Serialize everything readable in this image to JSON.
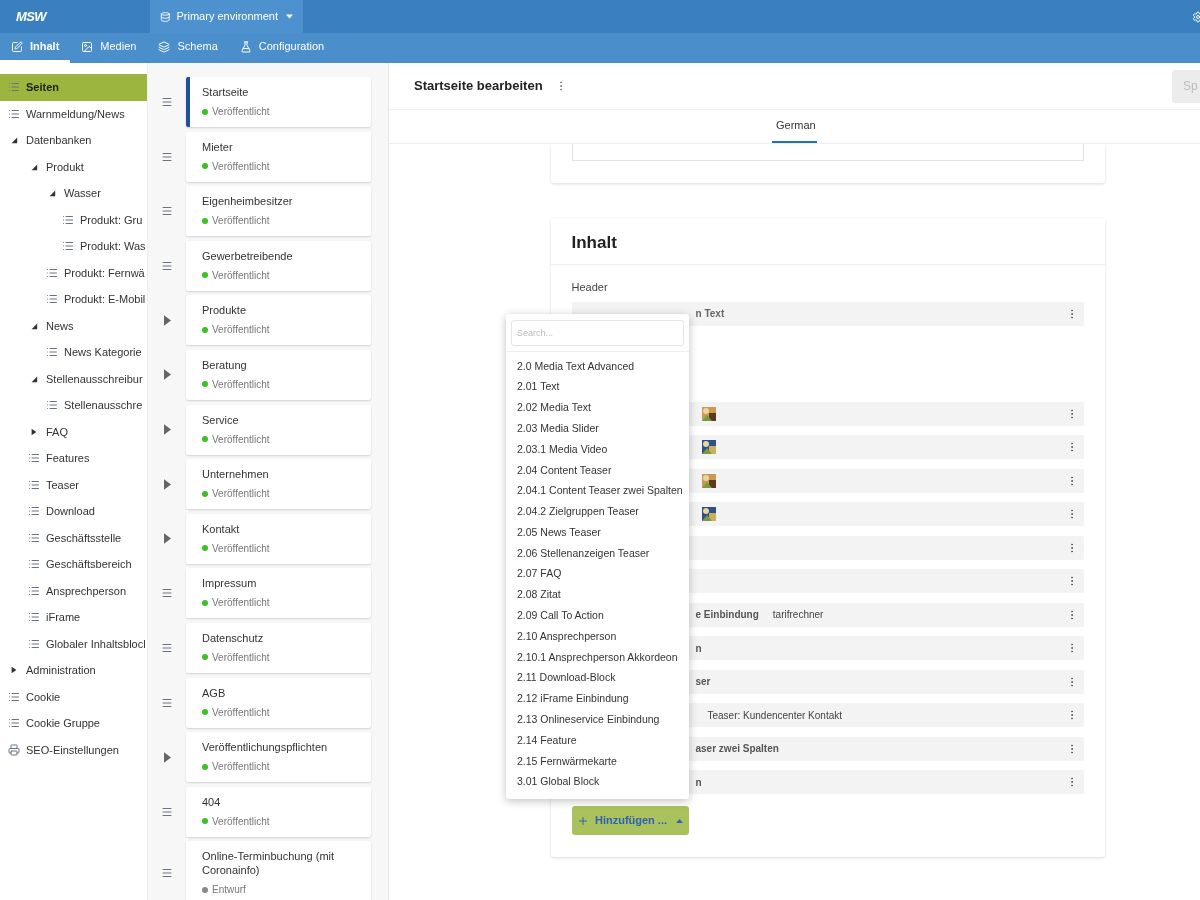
{
  "logo": "MSW",
  "environment": {
    "label": "Primary environment"
  },
  "nav": [
    {
      "label": "Inhalt",
      "selected": true
    },
    {
      "label": "Medien",
      "selected": false
    },
    {
      "label": "Schema",
      "selected": false
    },
    {
      "label": "Configuration",
      "selected": false
    }
  ],
  "sidebar": {
    "items": [
      {
        "label": "Seiten",
        "kind": "list",
        "selected": true
      },
      {
        "label": "Warnmeldung/News",
        "kind": "list",
        "selected": false
      },
      {
        "label": "Datenbanken",
        "kind": "folder",
        "expanded": true,
        "selected": false,
        "children": [
          {
            "label": "Produkt",
            "kind": "folder",
            "expanded": true,
            "selected": false,
            "children": [
              {
                "label": "Wasser",
                "kind": "folder",
                "expanded": true,
                "selected": false,
                "children": [
                  {
                    "label": "Produkt: Gru",
                    "kind": "list",
                    "selected": false
                  },
                  {
                    "label": "Produkt: Was",
                    "kind": "list",
                    "selected": false
                  }
                ]
              },
              {
                "label": "Produkt: Fernwä",
                "kind": "list",
                "selected": false
              },
              {
                "label": "Produkt: E-Mobil",
                "kind": "list",
                "selected": false
              }
            ]
          },
          {
            "label": "News",
            "kind": "folder",
            "expanded": true,
            "selected": false,
            "children": [
              {
                "label": "News Kategorie",
                "kind": "list",
                "selected": false
              }
            ]
          },
          {
            "label": "Stellenausschreibur",
            "kind": "folder",
            "expanded": true,
            "selected": false,
            "children": [
              {
                "label": "Stellenausschre",
                "kind": "list",
                "selected": false
              }
            ]
          },
          {
            "label": "FAQ",
            "kind": "folder",
            "expanded": false,
            "selected": false
          },
          {
            "label": "Features",
            "kind": "list",
            "selected": false
          },
          {
            "label": "Teaser",
            "kind": "list",
            "selected": false
          },
          {
            "label": "Download",
            "kind": "list",
            "selected": false
          },
          {
            "label": "Geschäftsstelle",
            "kind": "list",
            "selected": false
          },
          {
            "label": "Geschäftsbereich",
            "kind": "list",
            "selected": false
          },
          {
            "label": "Ansprechperson",
            "kind": "list",
            "selected": false
          },
          {
            "label": "iFrame",
            "kind": "list",
            "selected": false
          },
          {
            "label": "Globaler Inhaltsblocl",
            "kind": "list",
            "selected": false
          }
        ]
      },
      {
        "label": "Administration",
        "kind": "folder",
        "expanded": false,
        "selected": false
      },
      {
        "label": "Cookie",
        "kind": "list",
        "selected": false
      },
      {
        "label": "Cookie Gruppe",
        "kind": "list",
        "selected": false
      },
      {
        "label": "SEO-Einstellungen",
        "kind": "settings",
        "selected": false
      }
    ]
  },
  "pages": [
    {
      "title": "Startseite",
      "status": "Veröffentlicht",
      "published": true,
      "kind": "leaf",
      "selected": true
    },
    {
      "title": "Mieter",
      "status": "Veröffentlicht",
      "published": true,
      "kind": "leaf",
      "selected": false
    },
    {
      "title": "Eigenheimbesitzer",
      "status": "Veröffentlicht",
      "published": true,
      "kind": "leaf",
      "selected": false
    },
    {
      "title": "Gewerbetreibende",
      "status": "Veröffentlicht",
      "published": true,
      "kind": "leaf",
      "selected": false
    },
    {
      "title": "Produkte",
      "status": "Veröffentlicht",
      "published": true,
      "kind": "parent",
      "selected": false
    },
    {
      "title": "Beratung",
      "status": "Veröffentlicht",
      "published": true,
      "kind": "parent",
      "selected": false
    },
    {
      "title": "Service",
      "status": "Veröffentlicht",
      "published": true,
      "kind": "parent",
      "selected": false
    },
    {
      "title": "Unternehmen",
      "status": "Veröffentlicht",
      "published": true,
      "kind": "parent",
      "selected": false
    },
    {
      "title": "Kontakt",
      "status": "Veröffentlicht",
      "published": true,
      "kind": "parent",
      "selected": false
    },
    {
      "title": "Impressum",
      "status": "Veröffentlicht",
      "published": true,
      "kind": "leaf",
      "selected": false
    },
    {
      "title": "Datenschutz",
      "status": "Veröffentlicht",
      "published": true,
      "kind": "leaf",
      "selected": false
    },
    {
      "title": "AGB",
      "status": "Veröffentlicht",
      "published": true,
      "kind": "leaf",
      "selected": false
    },
    {
      "title": "Veröffentlichungspflichten",
      "status": "Veröffentlicht",
      "published": true,
      "kind": "parent",
      "selected": false
    },
    {
      "title": "404",
      "status": "Veröffentlicht",
      "published": true,
      "kind": "leaf",
      "selected": false
    },
    {
      "title": "Online-Terminbuchung (mit Coronainfo)",
      "status": "Entwurf",
      "published": false,
      "kind": "leaf",
      "selected": false
    }
  ],
  "editor": {
    "title": "Startseite bearbeiten",
    "save_button": "Sp",
    "languages": [
      {
        "label": "German",
        "selected": true
      }
    ],
    "section": {
      "title": "Inhalt",
      "header_label": "Header",
      "header_row": {
        "text": "n Text"
      },
      "rows": [
        {
          "kind": "picture"
        },
        {
          "kind": "picture"
        },
        {
          "kind": "picture"
        },
        {
          "kind": "picture"
        },
        {
          "kind": "text"
        },
        {
          "kind": "text"
        },
        {
          "kind": "text",
          "title": "e Einbindung",
          "subtitle": "tarifrechner"
        },
        {
          "kind": "text",
          "title": "n"
        },
        {
          "kind": "text",
          "title": "ser"
        },
        {
          "kind": "text",
          "subtitle": "Teaser: Kundencenter Kontakt"
        },
        {
          "kind": "text",
          "title": "aser zwei Spalten"
        },
        {
          "kind": "text",
          "title": "n"
        }
      ],
      "add_button": "Hinzufügen ..."
    }
  },
  "dropdown": {
    "placeholder": "Search...",
    "items": [
      "2.0 Media Text Advanced",
      "2.01 Text",
      "2.02 Media Text",
      "2.03 Media Slider",
      "2.03.1 Media Video",
      "2.04 Content Teaser",
      "2.04.1 Content Teaser zwei Spalten",
      "2.04.2 Zielgruppen Teaser",
      "2.05 News Teaser",
      "2.06 Stellenanzeigen Teaser",
      "2.07 FAQ",
      "2.08 Zitat",
      "2.09 Call To Action",
      "2.10 Ansprechperson",
      "2.10.1 Ansprechperson Akkordeon",
      "2.11 Download-Block",
      "2.12 iFrame Einbindung",
      "2.13 Onlineservice Einbindung",
      "2.14 Feature",
      "2.15 Fernwärmekarte",
      "3.01 Global Block"
    ]
  }
}
